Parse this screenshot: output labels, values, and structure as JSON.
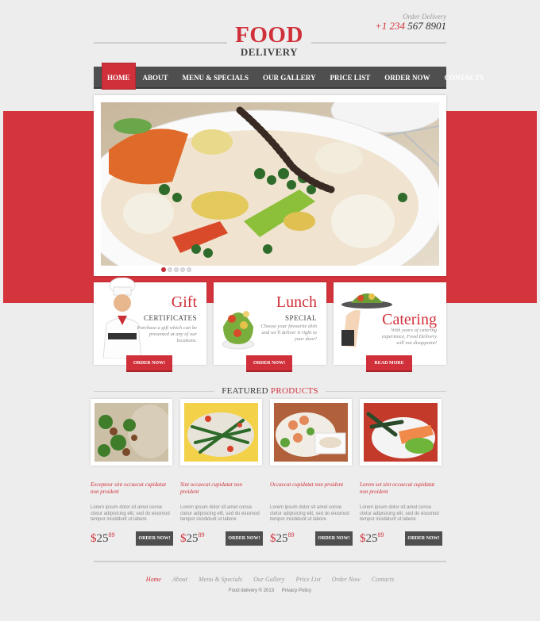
{
  "header": {
    "logo_main": "FOOD",
    "logo_sub": "DELIVERY",
    "order_label": "Order Delivery",
    "phone_prefix": "+1 234",
    "phone_number": "567 8901"
  },
  "nav": {
    "items": [
      "HOME",
      "ABOUT",
      "MENU & SPECIALS",
      "OUR GALLERY",
      "PRICE LIST",
      "ORDER NOW",
      "CONTACTS"
    ],
    "active": "HOME"
  },
  "slider": {
    "slide_count": 5,
    "active_slide": 1
  },
  "promos": [
    {
      "title": "Gift",
      "subtitle": "CERTIFICATES",
      "description": "Purchase a gift which can be presented at any of our locations.",
      "button": "ORDER NOW!"
    },
    {
      "title": "Lunch",
      "subtitle": "SPECIAL",
      "description": "Choose your favourite dish and we'll deliver it right to your door!",
      "button": "ORDER NOW!"
    },
    {
      "title": "Catering",
      "subtitle": "",
      "description": "With years of catering experience, Food Delivery will not disappoint!",
      "button": "READ MORE"
    }
  ],
  "featured": {
    "title_plain": "FEATURED",
    "title_highlight": "PRODUCTS"
  },
  "products": [
    {
      "title": "Excepteur sint occaecat cupidatat non proident",
      "text": "Lorem ipsum dolor sit amet conse ctetur adipisicing elit, sed do eiusmod tempor incididunt ut labore",
      "price_currency": "$",
      "price_whole": "25",
      "price_cents": "89",
      "button": "ORDER NOW!"
    },
    {
      "title": "Sint occaecat cupidatat non proident",
      "text": "Lorem ipsum dolor sit amet conse ctetur adipisicing elit, sed do eiusmod tempor incididunt ut labore",
      "price_currency": "$",
      "price_whole": "25",
      "price_cents": "89",
      "button": "ORDER NOW!"
    },
    {
      "title": "Occaecat cupidatat non proident",
      "text": "Lorem ipsum dolor sit amet conse ctetur adipisicing elit, sed do eiusmod tempor incididunt ut labore",
      "price_currency": "$",
      "price_whole": "25",
      "price_cents": "89",
      "button": "ORDER NOW!"
    },
    {
      "title": "Lorem set sint occaecat cupidatat non proident",
      "text": "Lorem ipsum dolor sit amet conse ctetur adipisicing elit, sed do eiusmod tempor incididunt ut labore",
      "price_currency": "$",
      "price_whole": "25",
      "price_cents": "89",
      "button": "ORDER NOW!"
    }
  ],
  "footer": {
    "links": [
      "Home",
      "About",
      "Menu & Specials",
      "Our Gallery",
      "Price List",
      "Order Now",
      "Contacts"
    ],
    "active": "Home",
    "copyright": "Food delivery © 2013",
    "privacy": "Privacy Policy"
  },
  "colors": {
    "accent": "#d0303a",
    "nav_bg": "#4f4f4f",
    "page_bg": "#ededed"
  }
}
